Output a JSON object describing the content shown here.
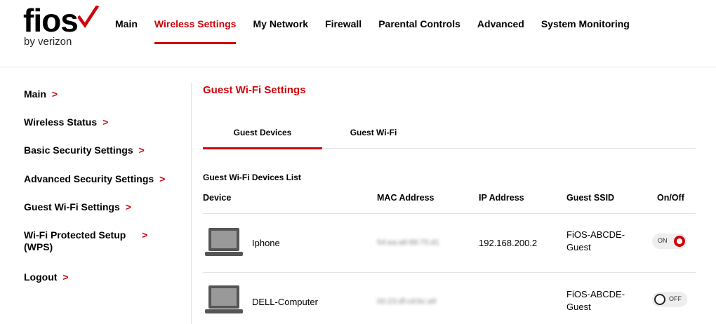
{
  "brand": {
    "name": "fios",
    "tagline": "by verizon",
    "accent_color": "#cd040b"
  },
  "topnav": [
    {
      "label": "Main",
      "active": false
    },
    {
      "label": "Wireless Settings",
      "active": true
    },
    {
      "label": "My Network",
      "active": false
    },
    {
      "label": "Firewall",
      "active": false
    },
    {
      "label": "Parental Controls",
      "active": false
    },
    {
      "label": "Advanced",
      "active": false
    },
    {
      "label": "System Monitoring",
      "active": false
    }
  ],
  "sidebar": [
    {
      "label": "Main"
    },
    {
      "label": "Wireless Status"
    },
    {
      "label": "Basic Security Settings"
    },
    {
      "label": "Advanced Security Settings"
    },
    {
      "label": "Guest Wi-Fi Settings"
    },
    {
      "label": "Wi-Fi Protected Setup (WPS)"
    },
    {
      "label": "Logout"
    }
  ],
  "main": {
    "title": "Guest Wi-Fi Settings",
    "tabs": [
      {
        "label": "Guest Devices",
        "active": true
      },
      {
        "label": "Guest Wi-Fi",
        "active": false
      }
    ],
    "list_title": "Guest Wi-Fi Devices List",
    "columns": [
      "Device",
      "MAC Address",
      "IP Address",
      "Guest SSID",
      "On/Off"
    ],
    "devices": [
      {
        "icon": "laptop-icon",
        "name": "Iphone",
        "mac": "54:ea:a8:88:75:d1",
        "ip": "192.168.200.2",
        "ssid": "FiOS-ABCDE-Guest",
        "toggle": "ON"
      },
      {
        "icon": "laptop-icon",
        "name": "DELL-Computer",
        "mac": "00:23:df:cd:bc:a9",
        "ip": "",
        "ssid": "FiOS-ABCDE-Guest",
        "toggle": "OFF"
      }
    ]
  }
}
